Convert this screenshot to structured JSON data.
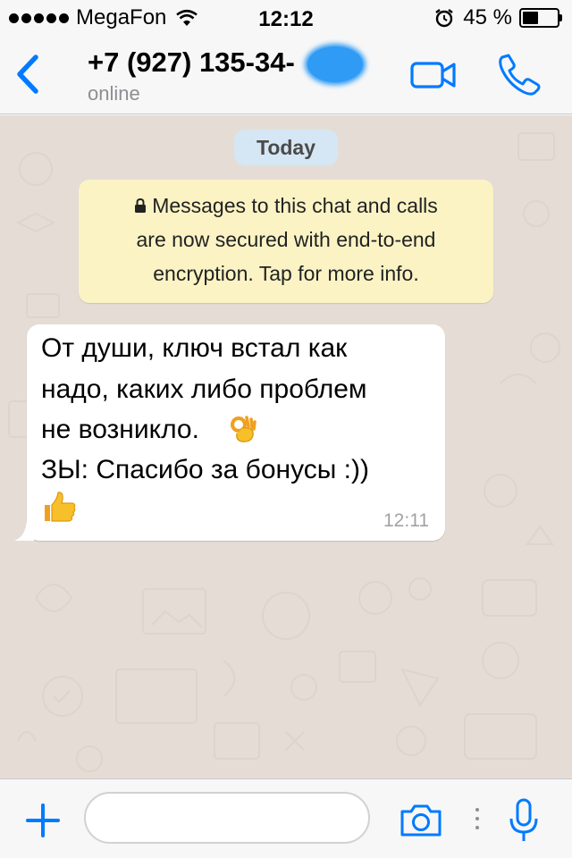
{
  "status_bar": {
    "carrier": "MegaFon",
    "time": "12:12",
    "battery_percent": "45 %",
    "battery_level": 0.45
  },
  "header": {
    "contact_name": "+7 (927) 135-34-",
    "contact_status": "online",
    "icons": [
      "back-chevron-icon",
      "video-camera-icon",
      "phone-icon"
    ]
  },
  "chat": {
    "date_label": "Today",
    "encryption_notice": {
      "lines": [
        "Messages to this chat and calls",
        "are now secured with end-to-end",
        "encryption. Tap for more info."
      ]
    },
    "message": {
      "lines": [
        "От души, ключ встал как",
        "надо, каких либо проблем",
        "не возникло.",
        "ЗЫ: Спасибо за бонусы :))"
      ],
      "time": "12:11",
      "emojis": [
        "ok-hand-icon",
        "thumbs-up-icon"
      ]
    }
  },
  "input_bar": {
    "placeholder": "",
    "icons": [
      "plus-icon",
      "camera-icon",
      "microphone-icon"
    ]
  },
  "colors": {
    "accent": "#007aff",
    "wallpaper": "#e5ddd5",
    "notice_bg": "#fbf3c4",
    "date_pill_bg": "#d5e6f4",
    "bubble_bg": "#ffffff"
  }
}
